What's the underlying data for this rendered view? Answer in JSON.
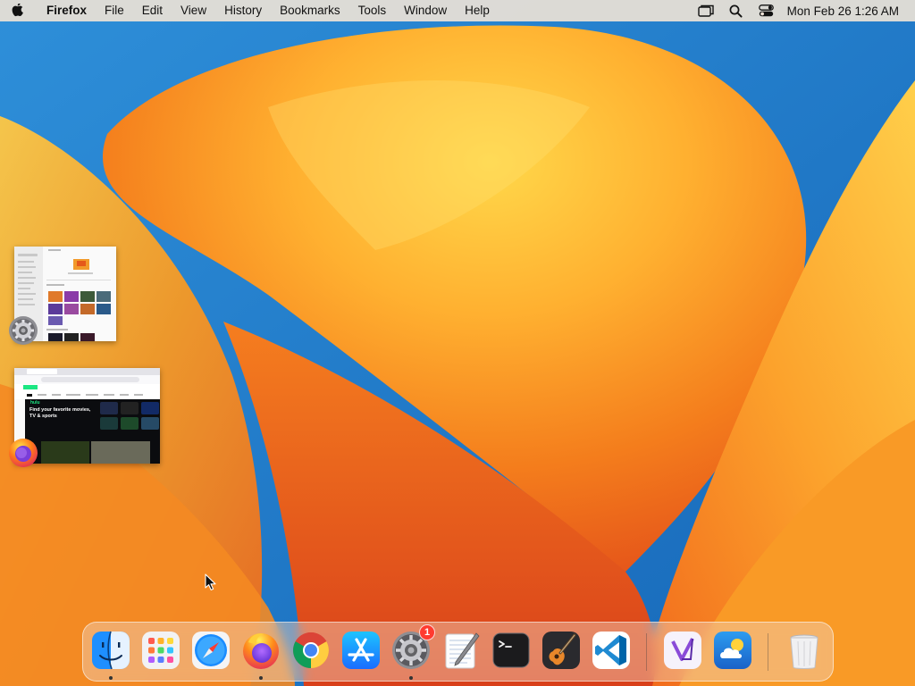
{
  "menubar": {
    "app_name": "Firefox",
    "menus": [
      "File",
      "Edit",
      "View",
      "History",
      "Bookmarks",
      "Tools",
      "Window",
      "Help"
    ],
    "clock": "Mon Feb 26  1:26 AM"
  },
  "minimized_windows": [
    {
      "app": "System Settings",
      "icon": "gear-icon"
    },
    {
      "app": "Firefox",
      "icon": "firefox-icon",
      "page": {
        "site": "hulu",
        "headline_line1": "Find your favorite movies,",
        "headline_line2": "TV & sports"
      }
    }
  ],
  "dock": {
    "items": [
      {
        "name": "Finder",
        "icon": "finder-icon",
        "running": true
      },
      {
        "name": "Launchpad",
        "icon": "launchpad-icon",
        "running": false
      },
      {
        "name": "Safari",
        "icon": "safari-icon",
        "running": false
      },
      {
        "name": "Firefox",
        "icon": "firefox-icon",
        "running": true
      },
      {
        "name": "Google Chrome",
        "icon": "chrome-icon",
        "running": false
      },
      {
        "name": "App Store",
        "icon": "app-store-icon",
        "running": false
      },
      {
        "name": "System Settings",
        "icon": "gear-icon",
        "running": true,
        "badge": "1"
      },
      {
        "name": "TextEdit",
        "icon": "textedit-icon",
        "running": false
      },
      {
        "name": "Terminal",
        "icon": "terminal-icon",
        "running": false
      },
      {
        "name": "GarageBand",
        "icon": "guitar-icon",
        "running": false
      },
      {
        "name": "Visual Studio Code",
        "icon": "vscode-icon",
        "running": false
      },
      {
        "name": "Visual Studio",
        "icon": "visual-studio-icon",
        "running": false
      },
      {
        "name": "Weather",
        "icon": "weather-icon",
        "running": false
      },
      {
        "name": "Trash",
        "icon": "trash-icon",
        "running": false
      }
    ],
    "badge_color": "#ff3b30"
  },
  "colors": {
    "wallpaper_blue": "#1f7fd0",
    "wallpaper_orange": "#f59a1e",
    "wallpaper_red": "#e4521a",
    "menubar_bg": "#ece2d6"
  }
}
